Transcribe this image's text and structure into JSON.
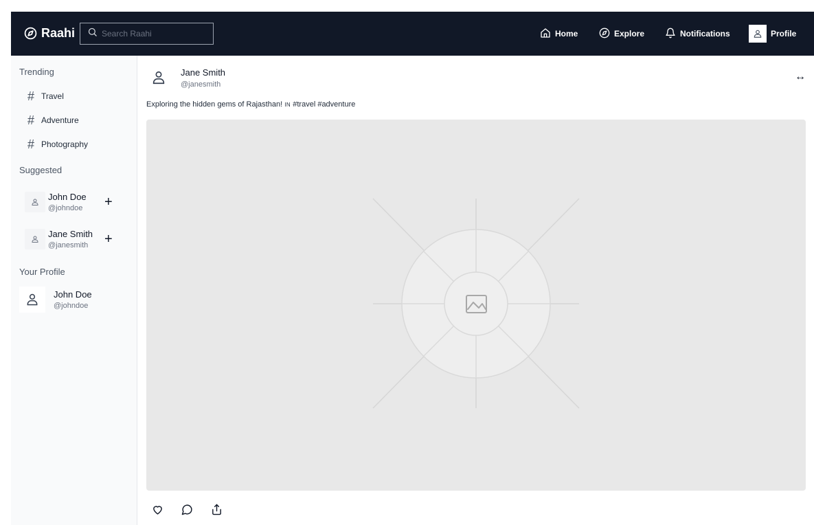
{
  "brand": {
    "name": "Raahi",
    "logo_icon": "compass-icon"
  },
  "search": {
    "placeholder": "Search Raahi"
  },
  "nav": {
    "home": "Home",
    "explore": "Explore",
    "notifications": "Notifications",
    "profile": "Profile"
  },
  "sidebar": {
    "trending_title": "Trending",
    "trending": [
      {
        "label": "Travel"
      },
      {
        "label": "Adventure"
      },
      {
        "label": "Photography"
      }
    ],
    "suggested_title": "Suggested",
    "suggested": [
      {
        "name": "John Doe",
        "handle": "@johndoe"
      },
      {
        "name": "Jane Smith",
        "handle": "@janesmith"
      }
    ],
    "profile_title": "Your Profile",
    "profile": {
      "name": "John Doe",
      "handle": "@johndoe"
    }
  },
  "post": {
    "author": "Jane Smith",
    "handle": "@janesmith",
    "caption_text": "Exploring the hidden gems of Rajasthan!",
    "caption_flag": "IN",
    "caption_tags": "#travel #adventure",
    "expand_glyph": "↔"
  },
  "colors": {
    "topbar": "#111827",
    "sidebar": "#f9fafb",
    "image_placeholder": "#e8e8e8"
  }
}
